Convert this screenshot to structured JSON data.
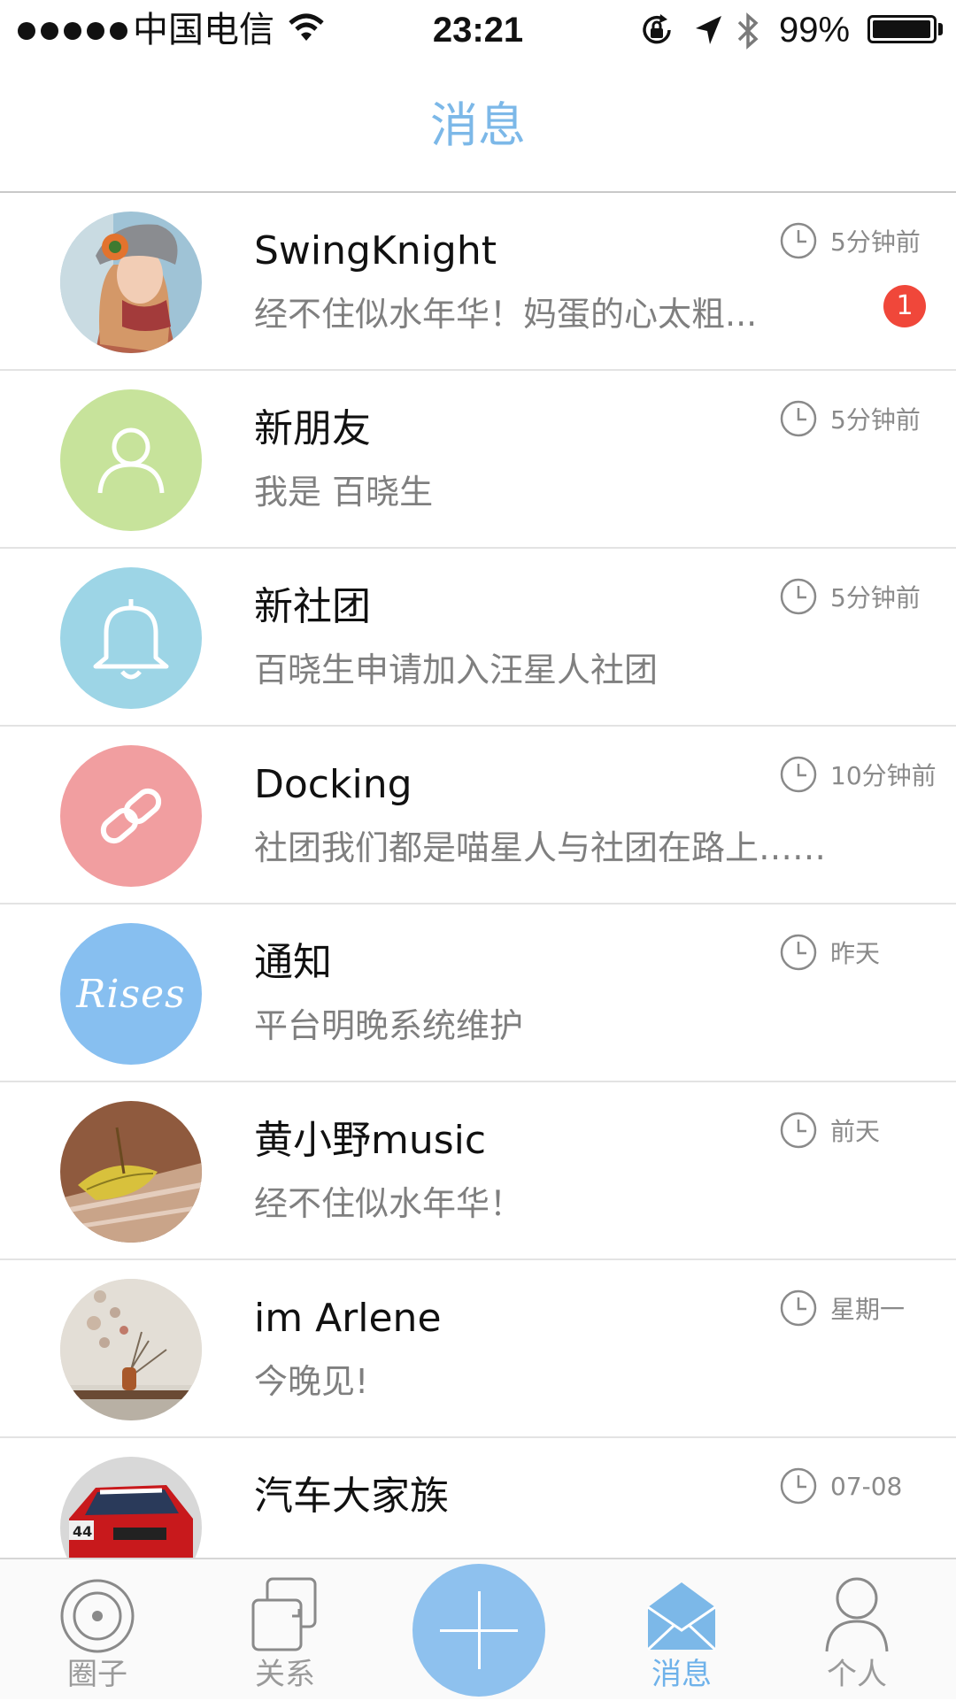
{
  "status_bar": {
    "carrier": "中国电信",
    "time": "23:21",
    "battery": "99%",
    "battery_level": 0.99
  },
  "header": {
    "title": "消息"
  },
  "colors": {
    "accent": "#7cb8e8",
    "badge": "#f0473a",
    "friend_avatar": "#c7e39b",
    "group_avatar": "#9dd5e6",
    "docking_avatar": "#f19ea0",
    "notice_avatar": "#87bff0"
  },
  "messages": [
    {
      "name": "SwingKnight",
      "preview": "经不住似水年华！妈蛋的心太粗...",
      "time": "5分钟前",
      "badge": "1",
      "avatar": "photo-woman-hat"
    },
    {
      "name": "新朋友",
      "preview": "我是  百晓生",
      "time": "5分钟前",
      "avatar": "person-icon"
    },
    {
      "name": "新社团",
      "preview": "百晓生申请加入汪星人社团",
      "time": "5分钟前",
      "avatar": "bell-icon"
    },
    {
      "name": "Docking",
      "preview": "社团我们都是喵星人与社团在路上……",
      "time": "10分钟前",
      "avatar": "link-icon"
    },
    {
      "name": "通知",
      "preview": "平台明晚系统维护",
      "time": "昨天",
      "avatar": "rises-logo",
      "avatar_text": "Rises"
    },
    {
      "name": "黄小野music",
      "preview": "经不住似水年华！",
      "time": "前天",
      "avatar": "photo-leaf"
    },
    {
      "name": "im Arlene",
      "preview": "今晚见!",
      "time": "星期一",
      "avatar": "photo-vase"
    },
    {
      "name": "汽车大家族",
      "preview": "",
      "time": "07-08",
      "avatar": "photo-car"
    }
  ],
  "tabs": [
    {
      "label": "圈子",
      "icon": "circle-target-icon",
      "active": false
    },
    {
      "label": "关系",
      "icon": "relation-icon",
      "active": false
    },
    {
      "label": "",
      "icon": "plus-icon",
      "active": false
    },
    {
      "label": "消息",
      "icon": "mail-icon",
      "active": true
    },
    {
      "label": "个人",
      "icon": "person-icon",
      "active": false
    }
  ]
}
